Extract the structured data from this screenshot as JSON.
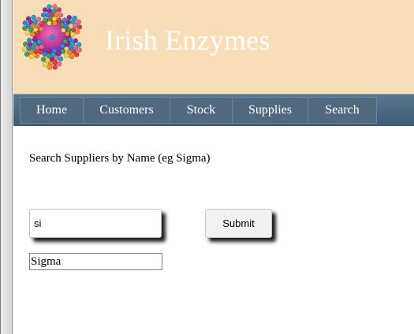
{
  "header": {
    "site_title": "Irish Enzymes",
    "logo_icon": "molecule-cluster-logo"
  },
  "nav": {
    "items": [
      {
        "label": "Home"
      },
      {
        "label": "Customers"
      },
      {
        "label": "Stock"
      },
      {
        "label": "Supplies"
      },
      {
        "label": "Search"
      }
    ]
  },
  "search": {
    "label": "Search Suppliers by Name (eg Sigma)",
    "input_value": "si",
    "submit_label": "Submit"
  },
  "results": {
    "items": [
      "Sigma"
    ]
  },
  "colors": {
    "header_bg": "#f7deb6",
    "nav_bg": "#4d6781",
    "title_text": "#ffffff"
  }
}
